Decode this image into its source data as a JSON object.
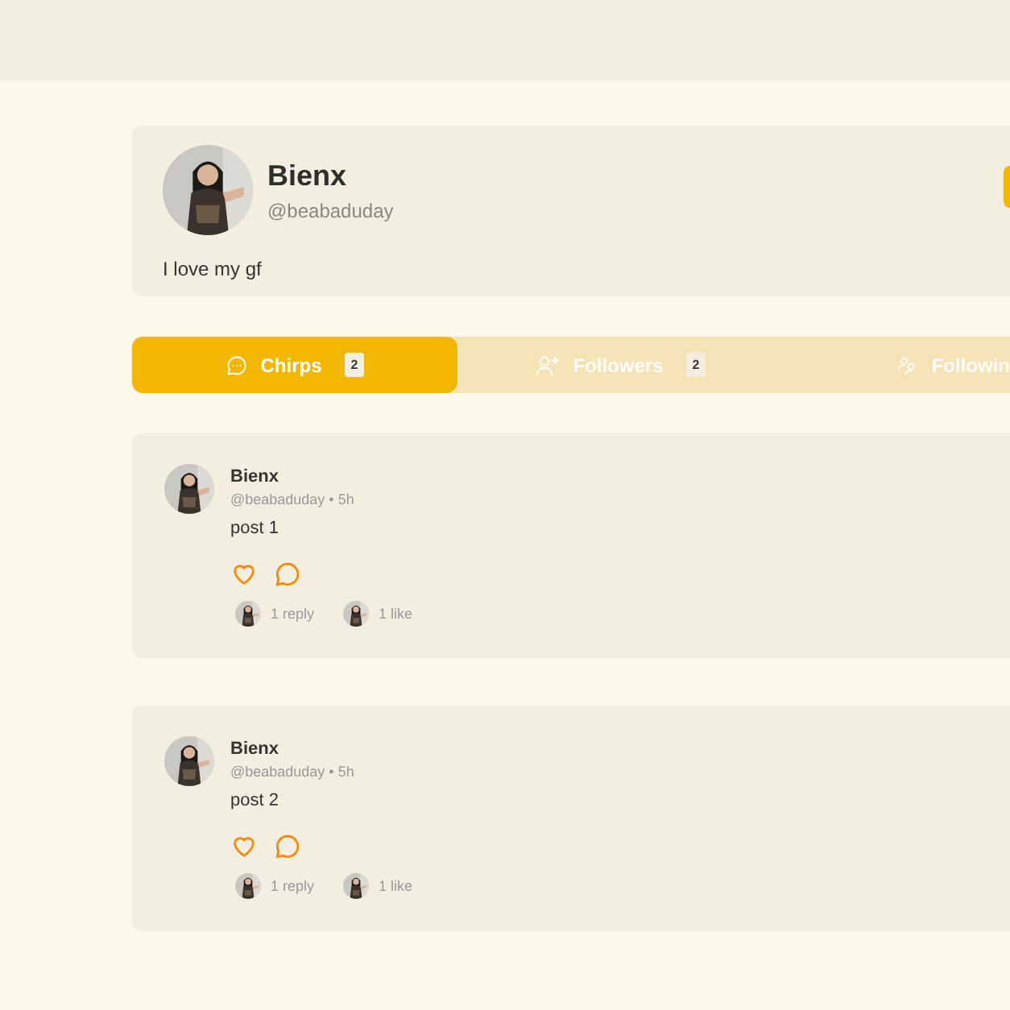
{
  "profile": {
    "name": "Bienx",
    "handle": "@beabaduday",
    "bio": "I love my gf"
  },
  "tabs": [
    {
      "label": "Chirps",
      "count": "2",
      "kind": "posts",
      "selected": true
    },
    {
      "label": "Followers",
      "count": "2",
      "kind": "followers",
      "selected": false
    },
    {
      "label": "Followin",
      "kind": "following",
      "selected": false
    }
  ],
  "posts": [
    {
      "name": "Bienx",
      "meta": "@beabaduday • 5h",
      "text": "post 1",
      "replies": "1 reply",
      "likes": "1 like"
    },
    {
      "name": "Bienx",
      "meta": "@beabaduday • 5h",
      "text": "post 2",
      "replies": "1 reply",
      "likes": "1 like"
    }
  ]
}
